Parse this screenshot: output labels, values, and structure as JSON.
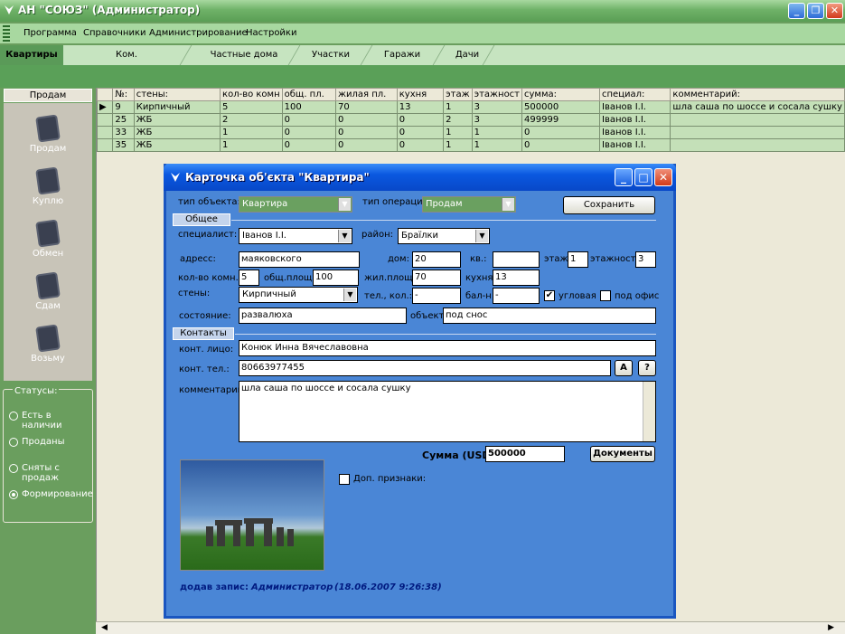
{
  "app": {
    "title": "АН \"СОЮЗ\" (Администратор)"
  },
  "menu": [
    "Программа",
    "Справочники",
    "Администрирование",
    "Настройки"
  ],
  "tabs": [
    "Квартиры",
    "Ком. недвижимость",
    "Частные дома",
    "Участки",
    "Гаражи",
    "Дачи"
  ],
  "left": {
    "header": "Продам",
    "items": [
      "Продам",
      "Куплю",
      "Обмен",
      "Сдам",
      "Возьму"
    ],
    "status_caption": "Статусы:",
    "statuses": [
      "Есть в наличии",
      "Проданы",
      "Сняты с продаж",
      "Формирование"
    ],
    "status_selected": "Формирование"
  },
  "grid": {
    "columns": [
      "№:",
      "стены:",
      "кол-во комн",
      "общ. пл.",
      "жилая пл.",
      "кухня",
      "этаж",
      "этажност",
      "сумма:",
      "специал:",
      "комментарий:"
    ],
    "rows": [
      [
        "9",
        "Кирпичный",
        "5",
        "100",
        "70",
        "13",
        "1",
        "3",
        "500000",
        "Іванов І.І.",
        "шла саша по шоссе и сосала сушку"
      ],
      [
        "25",
        "ЖБ",
        "2",
        "0",
        "0",
        "0",
        "2",
        "3",
        "499999",
        "Іванов І.І.",
        ""
      ],
      [
        "33",
        "ЖБ",
        "1",
        "0",
        "0",
        "0",
        "1",
        "1",
        "0",
        "Іванов І.І.",
        ""
      ],
      [
        "35",
        "ЖБ",
        "1",
        "0",
        "0",
        "0",
        "1",
        "1",
        "0",
        "Іванов І.І.",
        ""
      ]
    ]
  },
  "dialog": {
    "title": "Карточка об'єкта \"Квартира\"",
    "obj_type_label": "тип объекта:",
    "obj_type": "Квартира",
    "op_type_label": "тип операции:",
    "op_type": "Продам",
    "save": "Сохранить",
    "section_general": "Общее",
    "specialist_label": "специалист:",
    "specialist": "Іванов І.І.",
    "district_label": "район:",
    "district": "Браїлки",
    "address_label": "адресс:",
    "address": "маяковского",
    "house_label": "дом:",
    "house": "20",
    "apt_label": "кв.:",
    "apt": "",
    "floor_label": "этаж:",
    "floor": "1",
    "floors_label": "этажность",
    "floors": "3",
    "rooms_label": "кол-во комн.:",
    "rooms": "5",
    "total_area_label": "общ.площ.:",
    "total_area": "100",
    "living_area_label": "жил.площ.:",
    "living_area": "70",
    "kitchen_label": "кухня:",
    "kitchen": "13",
    "walls_label": "стены:",
    "walls": "Кирпичный",
    "phone_count_label": "тел., кол.:",
    "phone_count": "-",
    "balcony_label": "бал-н:",
    "balcony": "-",
    "corner_label": "угловая",
    "corner_checked": "✔",
    "office_label": "под офис",
    "state_label": "состояние:",
    "state": "развалюха",
    "object_label": "объект:",
    "object": "под снос",
    "section_contacts": "Контакты",
    "contact_person_label": "конт. лицо:",
    "contact_person": "Конюк Инна Вячеславовна",
    "contact_phone_label": "конт. тел.:",
    "contact_phone": "80663977455",
    "btn_a": "A",
    "btn_q": "?",
    "comment_label": "комментарий:",
    "comment": "шла саша по шоссе и сосала сушку",
    "sum_label": "Сумма (USD):",
    "sum": "500000",
    "documents": "Документы",
    "extra_label": "Доп. признаки:",
    "added_label": "додав запис:",
    "added_by": "Администратор",
    "added_at": "(18.06.2007 9:26:38)"
  }
}
